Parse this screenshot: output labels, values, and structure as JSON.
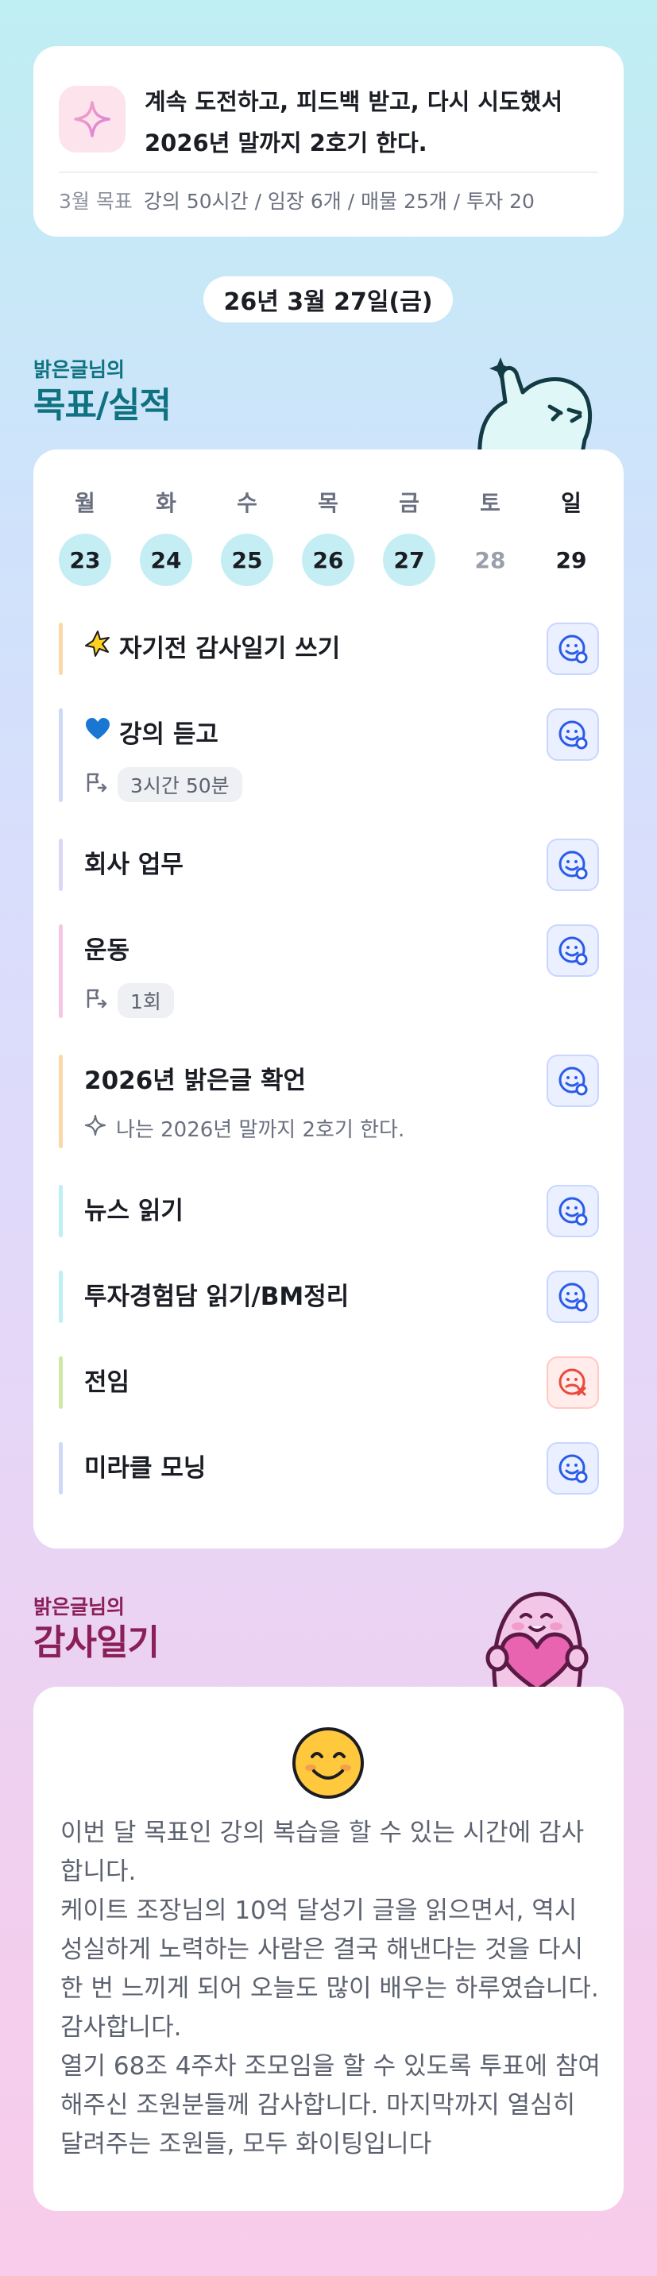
{
  "goal_banner": {
    "message": "계속 도전하고, 피드백 받고, 다시 시도했서 2026년 말까지 2호기 한다.",
    "month_label": "3월 목표",
    "month_goals": "강의 50시간 / 임장 6개 / 매물 25개 / 투자 20"
  },
  "date_label": "26년 3월 27일(금)",
  "goals_section": {
    "small_title": "밝은글님의",
    "big_title": "목표/실적"
  },
  "calendar": {
    "days": [
      {
        "dow": "월",
        "num": "23",
        "status": "done"
      },
      {
        "dow": "화",
        "num": "24",
        "status": "done"
      },
      {
        "dow": "수",
        "num": "25",
        "status": "done"
      },
      {
        "dow": "목",
        "num": "26",
        "status": "done"
      },
      {
        "dow": "금",
        "num": "27",
        "status": "done"
      },
      {
        "dow": "토",
        "num": "28",
        "status": "future"
      },
      {
        "dow": "일",
        "num": "29",
        "status": "sunday"
      }
    ]
  },
  "tasks": [
    {
      "title": "자기전 감사일기 쓰기",
      "emoji": "sparkle-star",
      "bar_color": "#fbd9a6",
      "state": "good"
    },
    {
      "title": "강의 듣고",
      "emoji": "blue-heart",
      "bar_color": "#cdd9f7",
      "state": "good",
      "chip": "3시간 50분"
    },
    {
      "title": "회사 업무",
      "bar_color": "#ddd6f7",
      "state": "good"
    },
    {
      "title": "운동",
      "bar_color": "#f5c6e3",
      "state": "good",
      "chip": "1회"
    },
    {
      "title": "2026년 밝은글 확언",
      "bar_color": "#fbd9a6",
      "state": "good",
      "note": "나는 2026년 말까지 2호기 한다."
    },
    {
      "title": "뉴스 읽기",
      "bar_color": "#bfeef3",
      "state": "good"
    },
    {
      "title": "투자경험담 읽기/BM정리",
      "bar_color": "#bfeef3",
      "state": "good"
    },
    {
      "title": "전임",
      "bar_color": "#cde9a6",
      "state": "bad"
    },
    {
      "title": "미라클 모닝",
      "bar_color": "#cdd9f7",
      "state": "good"
    }
  ],
  "diary_section": {
    "small_title": "밝은글님의",
    "big_title": "감사일기"
  },
  "diary": {
    "text": "이번 달 목표인 강의 복습을 할 수 있는 시간에 감사합니다.\n케이트 조장님의 10억 달성기 글을 읽으면서, 역시 성실하게 노력하는 사람은 결국 해낸다는 것을 다시 한 번 느끼게 되어 오늘도 많이 배우는 하루였습니다. 감사합니다.\n열기 68조 4주차 조모임을 할 수 있도록 투표에 참여해주신 조원분들께 감사합니다. 마지막까지 열심히 달려주는 조원들, 모두 화이팅입니다"
  },
  "colors": {
    "goals_title": "#0f7280",
    "diary_title": "#8a1f5a",
    "accent_blue": "#2a5be8",
    "accent_red": "#e64b3c"
  }
}
